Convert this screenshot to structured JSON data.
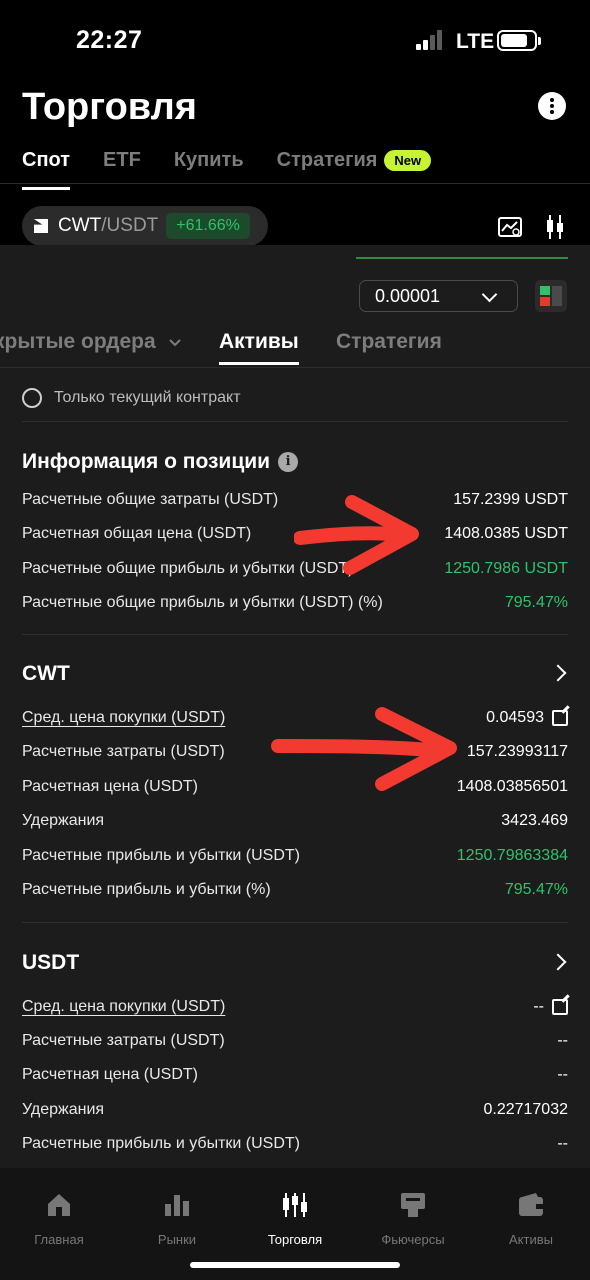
{
  "status_bar": {
    "time": "22:27",
    "network": "LTE"
  },
  "header": {
    "title": "Торговля",
    "menu_icon": "more-vertical-icon"
  },
  "top_tabs": [
    {
      "label": "Спот",
      "active": true
    },
    {
      "label": "ETF",
      "active": false
    },
    {
      "label": "Купить",
      "active": false
    },
    {
      "label": "Стратегия",
      "active": false,
      "badge": "New"
    }
  ],
  "pair": {
    "base": "CWT",
    "quote": "/USDT",
    "change": "+61.66%"
  },
  "order_book": {
    "precision": "0.00001"
  },
  "sub_tabs": [
    {
      "label": "крытые ордера",
      "active": false
    },
    {
      "label": "Активы",
      "active": true
    },
    {
      "label": "Стратегия",
      "active": false
    }
  ],
  "filter": {
    "label": "Только текущий контракт"
  },
  "position_info": {
    "title": "Информация о позиции",
    "rows": [
      {
        "label": "Расчетные общие затраты (USDT)",
        "value": "157.2399 USDT"
      },
      {
        "label": "Расчетная общая цена (USDT)",
        "value": "1408.0385 USDT"
      },
      {
        "label": "Расчетные общие прибыль и убытки (USDT)",
        "value": "1250.7986 USDT"
      },
      {
        "label": "Расчетные общие прибыль и убытки (USDT) (%)",
        "value": "795.47%"
      }
    ]
  },
  "cwt": {
    "title": "CWT",
    "rows": [
      {
        "label": "Сред. цена покупки (USDT)",
        "value": "0.04593"
      },
      {
        "label": "Расчетные затраты (USDT)",
        "value": "157.23993117"
      },
      {
        "label": "Расчетная цена (USDT)",
        "value": "1408.03856501"
      },
      {
        "label": "Удержания",
        "value": "3423.469"
      },
      {
        "label": "Расчетные прибыль и убытки (USDT)",
        "value": "1250.79863384"
      },
      {
        "label": "Расчетные прибыль и убытки (%)",
        "value": "795.47%"
      }
    ]
  },
  "usdt": {
    "title": "USDT",
    "rows": [
      {
        "label": "Сред. цена покупки (USDT)",
        "value": "--"
      },
      {
        "label": "Расчетные затраты (USDT)",
        "value": "--"
      },
      {
        "label": "Расчетная цена (USDT)",
        "value": "--"
      },
      {
        "label": "Удержания",
        "value": "0.22717032"
      },
      {
        "label": "Расчетные прибыль и убытки (USDT)",
        "value": "--"
      }
    ]
  },
  "colors": {
    "positive": "#2ec26a",
    "badge": "#c6f432",
    "annotation_arrow": "#f23a30"
  },
  "bottom_nav": [
    {
      "label": "Главная",
      "icon": "home-icon",
      "active": false
    },
    {
      "label": "Рынки",
      "icon": "markets-icon",
      "active": false
    },
    {
      "label": "Торговля",
      "icon": "trade-icon",
      "active": true
    },
    {
      "label": "Фьючерсы",
      "icon": "futures-icon",
      "active": false
    },
    {
      "label": "Активы",
      "icon": "wallet-icon",
      "active": false
    }
  ]
}
